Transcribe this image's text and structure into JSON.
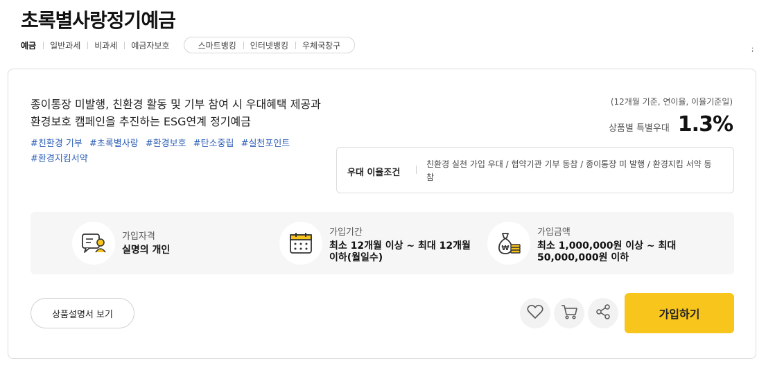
{
  "product": {
    "title": "초록별사랑정기예금",
    "tags": [
      "예금",
      "일반과세",
      "비과세",
      "예금자보호"
    ],
    "channels": [
      "스마트뱅킹",
      "인터넷뱅킹",
      "우체국창구"
    ],
    "corner_mark": ";"
  },
  "card": {
    "description": "종이통장 미발행, 친환경 활동 및 기부 참여 시 우대혜택 제공과 환경보호 캠페인을 추진하는 ESG연계 정기예금",
    "hashtags": [
      "#친환경 기부",
      "#초록별사랑",
      "#환경보호",
      "#탄소중립",
      "#실천포인트",
      "#환경지킴서약"
    ],
    "rate_note": "(12개월 기준, 연이율, 이율기준일)",
    "rate_label": "상품별 특별우대",
    "rate_value": "1.3%",
    "condition_label": "우대 이율조건",
    "condition_text": "친환경 실천 가입 우대  /  협약기관 기부 동참  /  종이통장 미 발행  /  환경지킴 서약 동참"
  },
  "info": {
    "eligibility": {
      "label": "가입자격",
      "value": "실명의 개인"
    },
    "period": {
      "label": "가입기간",
      "value": "최소 12개월 이상 ~ 최대 12개월 이하(월일수)"
    },
    "amount": {
      "label": "가입금액",
      "value": "최소 1,000,000원 이상 ~ 최대 50,000,000원 이하"
    }
  },
  "actions": {
    "doc_button": "상품설명서 보기",
    "join_button": "가입하기"
  },
  "colors": {
    "accent": "#f8c51c",
    "hashtag": "#2d5fb8"
  },
  "icons": [
    "person-chat-icon",
    "calendar-icon",
    "money-bag-icon",
    "heart-icon",
    "cart-icon",
    "share-icon"
  ]
}
